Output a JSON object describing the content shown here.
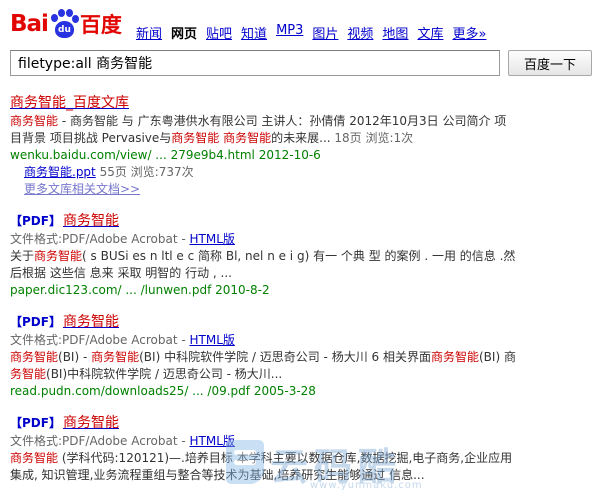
{
  "header": {
    "logo": {
      "bai": "Bai",
      "du": "du",
      "cn": "百度"
    },
    "nav": [
      {
        "label": "新闻",
        "current": false
      },
      {
        "label": "网页",
        "current": true
      },
      {
        "label": "贴吧",
        "current": false
      },
      {
        "label": "知道",
        "current": false
      },
      {
        "label": "MP3",
        "current": false
      },
      {
        "label": "图片",
        "current": false
      },
      {
        "label": "视频",
        "current": false
      },
      {
        "label": "地图",
        "current": false
      },
      {
        "label": "文库",
        "current": false
      },
      {
        "label": "更多»",
        "current": false
      }
    ]
  },
  "search": {
    "query": "filetype:all 商务智能",
    "button_label": "百度一下"
  },
  "results": {
    "r1": {
      "title": "商务智能_百度文库",
      "line1_em1": "商务智能",
      "line1_mid": " - 商务智能 与 广东粤港供水有限公司 主讲人：孙倩倩 2012年10月3日 公司简介 项",
      "line2_pre": "目背景 项目挑战 Pervasive与",
      "line2_em1": "商务智能",
      "line2_mid": " ",
      "line2_em2": "商务智能",
      "line2_post": "的未来展... ",
      "line2_meta": "18页 浏览:1次",
      "url": "wenku.baidu.com/view/ ... 279e9b4.html 2012-10-6",
      "sub_link": "商务智能.ppt",
      "sub_meta": " 55页 浏览:737次",
      "more": "更多文库相关文档>>"
    },
    "r2": {
      "tag": "【PDF】",
      "title": "商务智能",
      "fmt_label": "文件格式:PDF/Adobe Acrobat - ",
      "html_link": "HTML版",
      "line1_pre": "关于",
      "line1_em": "商务智能",
      "line1_post": "( s BUSi es n ltl e c 简称 Bl, nel n e i g) 有一 个典 型 的案例 . 一用 的信息 .然",
      "line2": "后根据 这些信 息来 采取 明智的 行动 , ...",
      "url": "paper.dic123.com/ ... /lunwen.pdf 2010-8-2"
    },
    "r3": {
      "tag": "【PDF】",
      "title": "商务智能",
      "fmt_label": "文件格式:PDF/Adobe Acrobat - ",
      "html_link": "HTML版",
      "line1_em1": "商务智能",
      "line1_a": "(BI) - ",
      "line1_em2": "商务智能",
      "line1_b": "(BI) 中科院软件学院 / 迈思奇公司 - 杨大川 6 相关界面",
      "line1_em3": "商务智能",
      "line1_c": "(BI) 商",
      "line2_em": "务智能",
      "line2_post": "(BI)中科院软件学院 / 迈思奇公司 - 杨大川...",
      "url": "read.pudn.com/downloads25/ ... /09.pdf 2005-3-28"
    },
    "r4": {
      "tag": "【PDF】",
      "title": "商务智能",
      "fmt_label": "文件格式:PDF/Adobe Acrobat - ",
      "html_link": "HTML版",
      "line1_em": "商务智能",
      "line1_post": " (学科代码:120121)—.培养目标 本学科主要以数据仓库,数据挖掘,电子商务,企业应用",
      "line2": "集成, 知识管理,业务流程重组与整合等技术为基础,培养研究生能够通过 信息..."
    }
  },
  "watermark": {
    "text": "云码酷",
    "sub": "www.yunmaku.com"
  },
  "colors": {
    "link": "#0000cc",
    "highlight": "#cc0000",
    "url": "#008000",
    "logo_red": "#e10602",
    "logo_blue": "#2932e1"
  }
}
